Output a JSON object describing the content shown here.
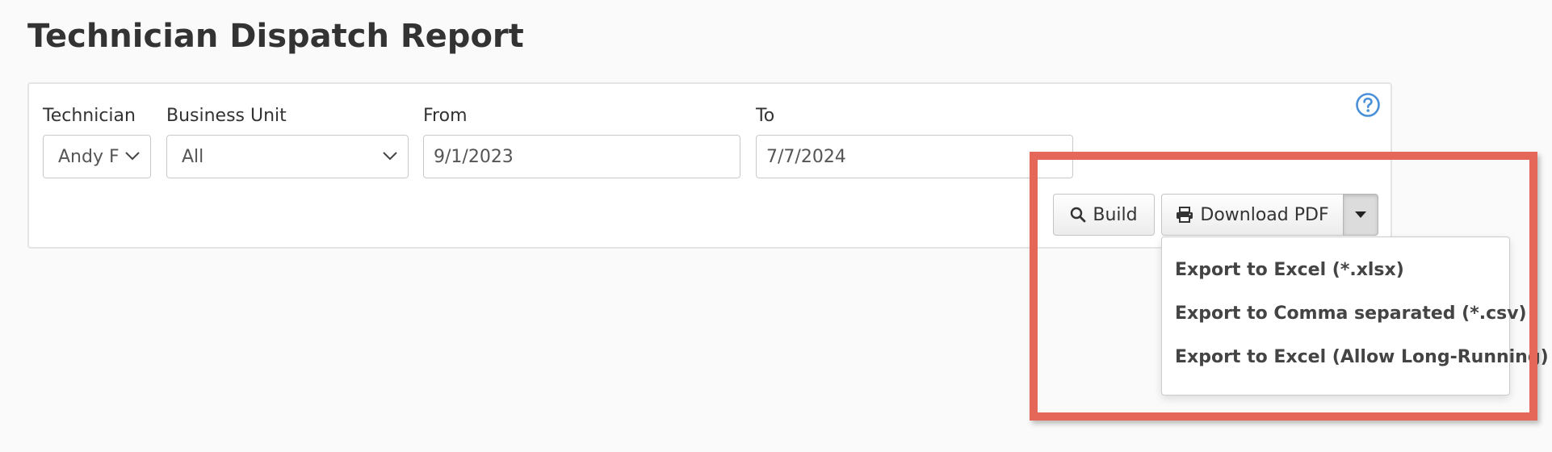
{
  "page": {
    "title": "Technician Dispatch Report"
  },
  "filters": {
    "technician": {
      "label": "Technician",
      "value": "Andy F"
    },
    "business_unit": {
      "label": "Business Unit",
      "value": "All"
    },
    "from": {
      "label": "From",
      "value": "9/1/2023"
    },
    "to": {
      "label": "To",
      "value": "7/7/2024"
    }
  },
  "toolbar": {
    "build_label": "Build",
    "download_label": "Download PDF"
  },
  "export_menu": {
    "items": [
      {
        "label": "Export to Excel (*.xlsx)"
      },
      {
        "label": "Export to Comma separated (*.csv)"
      },
      {
        "label": "Export to Excel (Allow Long-Running)"
      }
    ]
  },
  "colors": {
    "highlight": "#e4675a",
    "help_icon": "#4a90d9"
  },
  "icons": {
    "help": "question-circle-icon",
    "build": "search-icon",
    "download": "print-icon",
    "menu_toggle": "caret-down-icon",
    "select": "chevron-down-icon"
  }
}
